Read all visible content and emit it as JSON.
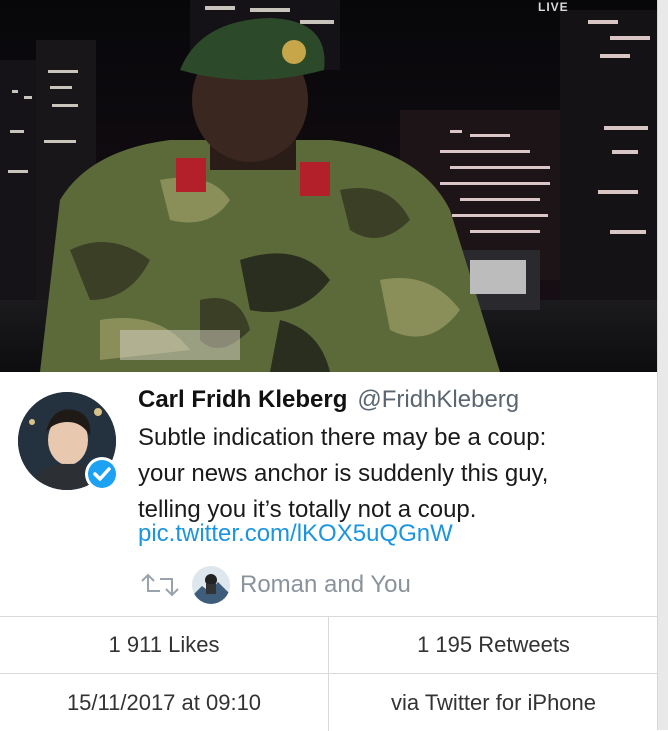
{
  "media": {
    "live_label": "LIVE",
    "beret_color": "#2c4a2a",
    "camo_colors": [
      "#5c6a3a",
      "#3b3f25",
      "#8a8f5a",
      "#2a2e1e"
    ]
  },
  "tweet": {
    "author_name": "Carl Fridh Kleberg",
    "author_handle": "@FridhKleberg",
    "text_lines": [
      "Subtle indication there may be a coup:",
      "your news anchor is suddenly this guy,",
      "telling you it’s totally not a coup."
    ],
    "link": "pic.twitter.com/lKOX5uQGnW",
    "link_color": "#1b95e0",
    "verified_color": "#1da1f2",
    "social_context": "Roman and You"
  },
  "stats": {
    "likes": "1 911 Likes",
    "retweets": "1 195 Retweets",
    "timestamp": "15/11/2017 at 09:10",
    "source": "via Twitter for iPhone"
  }
}
